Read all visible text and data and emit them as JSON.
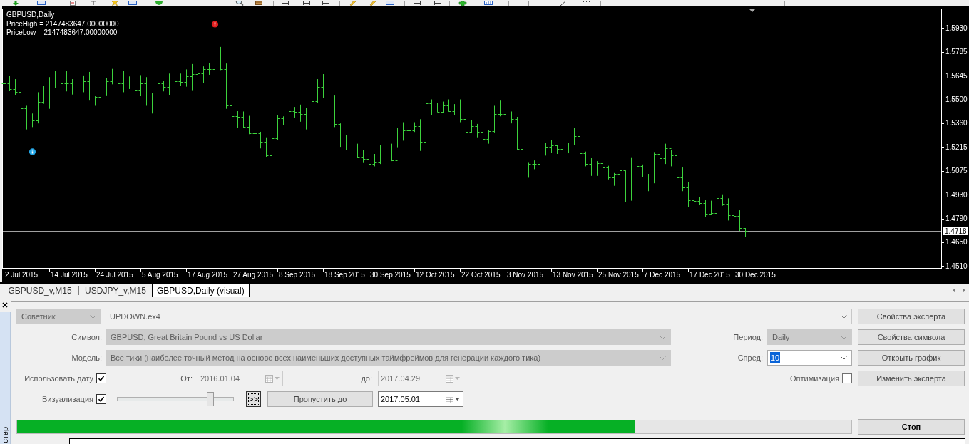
{
  "chart": {
    "title": "GBPUSD,Daily",
    "info_lines": [
      "PriceHigh = 2147483647.00000000",
      "PriceLow = 2147483647.00000000"
    ],
    "price_labels": [
      "1.5930",
      "1.5785",
      "1.5645",
      "1.5500",
      "1.5360",
      "1.5215",
      "1.5075",
      "1.4930",
      "1.4790",
      "1.4650",
      "1.4510"
    ],
    "current_price": "1.4718",
    "date_labels": [
      "2 Jul 2015",
      "14 Jul 2015",
      "24 Jul 2015",
      "5 Aug 2015",
      "17 Aug 2015",
      "27 Aug 2015",
      "8 Sep 2015",
      "18 Sep 2015",
      "30 Sep 2015",
      "12 Oct 2015",
      "22 Oct 2015",
      "3 Nov 2015",
      "13 Nov 2015",
      "25 Nov 2015",
      "7 Dec 2015",
      "17 Dec 2015",
      "30 Dec 2015"
    ]
  },
  "chart_tabs": [
    {
      "label": "GBPUSD_v,M15",
      "selected": false
    },
    {
      "label": "USDJPY_v,M15",
      "selected": false
    },
    {
      "label": "GBPUSD,Daily (visual)",
      "selected": true
    }
  ],
  "tester": {
    "panel_title": "стер",
    "expert_type": {
      "value": "Советник",
      "disabled": true
    },
    "expert_file": {
      "value": "UPDOWN.ex4",
      "disabled": true
    },
    "expert_properties_button": "Свойства эксперта",
    "symbol": {
      "label": "Символ:",
      "value": "GBPUSD, Great Britain Pound vs US Dollar",
      "disabled": true
    },
    "period": {
      "label": "Период:",
      "value": "Daily",
      "disabled": true
    },
    "symbol_properties_button": "Свойства символа",
    "model": {
      "label": "Модель:",
      "value": "Все тики (наиболее точный метод на основе всех наименьших доступных таймфреймов для генерации каждого тика)",
      "disabled": true
    },
    "spread": {
      "label": "Спред:",
      "value": "10",
      "highlighted": true
    },
    "open_chart_button": "Открыть график",
    "use_date": {
      "label": "Использовать дату",
      "checked": true
    },
    "from": {
      "label": "От:",
      "value": "2016.01.04",
      "disabled": true
    },
    "to": {
      "label": "до:",
      "value": "2017.04.29",
      "disabled": true
    },
    "optimization": {
      "label": "Оптимизация",
      "checked": false
    },
    "modify_expert_button": "Изменить эксперта",
    "visualization": {
      "label": "Визуализация",
      "checked": true
    },
    "speed_slider": {
      "level": 0.82
    },
    "step_button": ">>",
    "skip_to_button": "Пропустить до",
    "skip_to_date": {
      "value": "2017.05.01",
      "disabled": false
    },
    "progress": {
      "level": 0.74
    },
    "stop_button": "Стоп"
  }
}
